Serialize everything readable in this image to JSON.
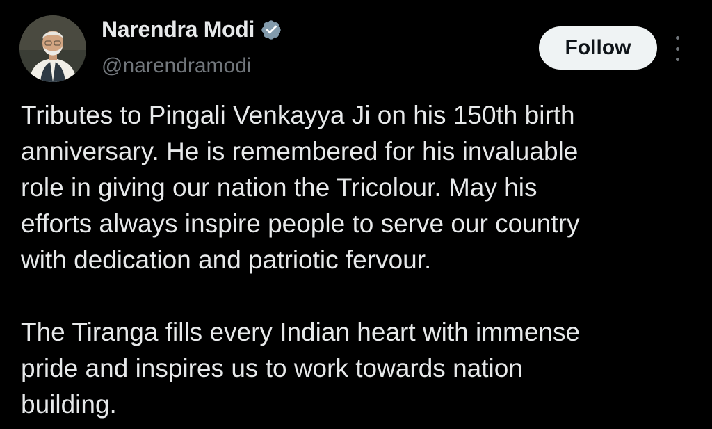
{
  "author": {
    "display_name": "Narendra Modi",
    "handle": "@narendramodi",
    "verified": true,
    "verified_color": "#829aab"
  },
  "actions": {
    "follow_label": "Follow",
    "more_icon": "more-vertical-icon"
  },
  "tweet": {
    "paragraphs": [
      "Tributes to Pingali Venkayya Ji on his 150th birth\nanniversary. He is remembered for his invaluable\nrole in giving our nation the Tricolour. May his\nefforts always inspire people to serve our country\nwith dedication and patriotic fervour.",
      "The Tiranga fills every Indian heart with immense\npride and inspires us to work towards nation\nbuilding."
    ]
  },
  "colors": {
    "background": "#000000",
    "text_primary": "#e7e9ea",
    "text_secondary": "#71767b",
    "follow_bg": "#eff3f4"
  }
}
